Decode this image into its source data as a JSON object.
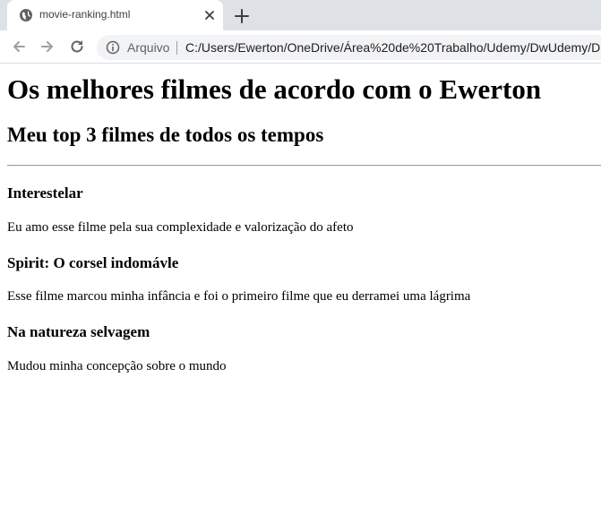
{
  "browser": {
    "tab": {
      "title": "movie-ranking.html"
    },
    "address_bar": {
      "security_label": "Arquivo",
      "url": "C:/Users/Ewerton/OneDrive/Área%20de%20Trabalho/Udemy/DwUdemy/Di"
    },
    "icons": {
      "favicon": "globe-icon",
      "close_tab": "close-icon",
      "new_tab": "plus-icon",
      "back": "arrow-left-icon",
      "forward": "arrow-right-icon",
      "reload": "reload-icon",
      "site_info": "info-icon"
    }
  },
  "page": {
    "title": "Os melhores filmes de acordo com o Ewerton",
    "subtitle": "Meu top 3 filmes de todos os tempos",
    "movies": [
      {
        "title": "Interestelar",
        "description": "Eu amo esse filme pela sua complexidade e valorização do afeto"
      },
      {
        "title": "Spirit: O corsel indomávle",
        "description": "Esse filme marcou minha infância e foi o primeiro filme que eu derramei uma lágrima"
      },
      {
        "title": "Na natureza selvagem",
        "description": "Mudou minha concepção sobre o mundo"
      }
    ]
  },
  "colors": {
    "tabbar_bg": "#dee1e6",
    "omnibox_bg": "#f1f3f4",
    "text": "#000000"
  }
}
